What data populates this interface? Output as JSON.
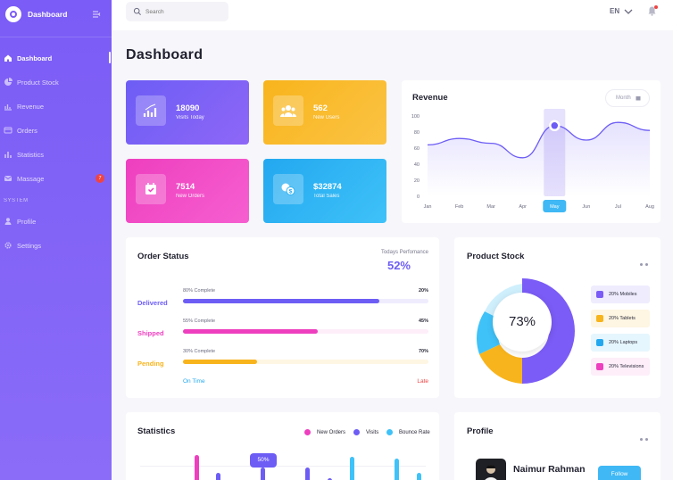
{
  "app": {
    "title": "Dashboard",
    "page_title": "Dashboard"
  },
  "sidebar": {
    "items": [
      {
        "label": "Dashboard"
      },
      {
        "label": "Product Stock"
      },
      {
        "label": "Revenue"
      },
      {
        "label": "Orders"
      },
      {
        "label": "Statistics"
      },
      {
        "label": "Massage",
        "badge": "7"
      }
    ],
    "section": "SYSTEM",
    "system_items": [
      {
        "label": "Profile"
      },
      {
        "label": "Settings"
      }
    ]
  },
  "topbar": {
    "search_placeholder": "Search",
    "language": "EN"
  },
  "cards": [
    {
      "value": "18090",
      "label": "Visits Today"
    },
    {
      "value": "562",
      "label": "New Users"
    },
    {
      "value": "7514",
      "label": "New Orders"
    },
    {
      "value": "$32874",
      "label": "Total Sales"
    }
  ],
  "revenue": {
    "title": "Revenue",
    "period": "Month"
  },
  "chart_data": {
    "type": "area",
    "categories": [
      "Jan",
      "Feb",
      "Mar",
      "Apr",
      "May",
      "Jun",
      "Jul",
      "Aug"
    ],
    "values": [
      64,
      72,
      66,
      48,
      88,
      70,
      92,
      82
    ],
    "highlight": "May",
    "ylim": [
      0,
      100
    ],
    "yticks": [
      "100",
      "80",
      "60",
      "40",
      "20",
      "0"
    ]
  },
  "order_status": {
    "title": "Order Status",
    "performance_label": "Todays Perfomance",
    "performance_value": "52%",
    "rows": [
      {
        "name": "Delivered",
        "sub": "80% Complete",
        "pct": "20%",
        "value": 0.8
      },
      {
        "name": "Shipped",
        "sub": "55% Complete",
        "pct": "45%",
        "value": 0.55
      },
      {
        "name": "Pending",
        "sub": "30% Complete",
        "pct": "70%",
        "value": 0.3
      }
    ],
    "on_time": "On Time",
    "late": "Late"
  },
  "product_stock": {
    "title": "Product Stock",
    "center": "73%",
    "legend": [
      {
        "label": "20% Mobiles"
      },
      {
        "label": "20% Tablets"
      },
      {
        "label": "20% Laptops"
      },
      {
        "label": "20% Televisions"
      }
    ]
  },
  "statistics": {
    "title": "Statistics",
    "legend": [
      "New Orders",
      "Visits",
      "Bounce Rate"
    ],
    "bubble": "50%"
  },
  "profile": {
    "title": "Profile",
    "name": "Naimur Rahman",
    "follow": "Follow"
  },
  "colors": {
    "purple": "#6d5df5",
    "pink": "#ee3fbf",
    "orange": "#f8b41c",
    "blue": "#23a8f0"
  }
}
